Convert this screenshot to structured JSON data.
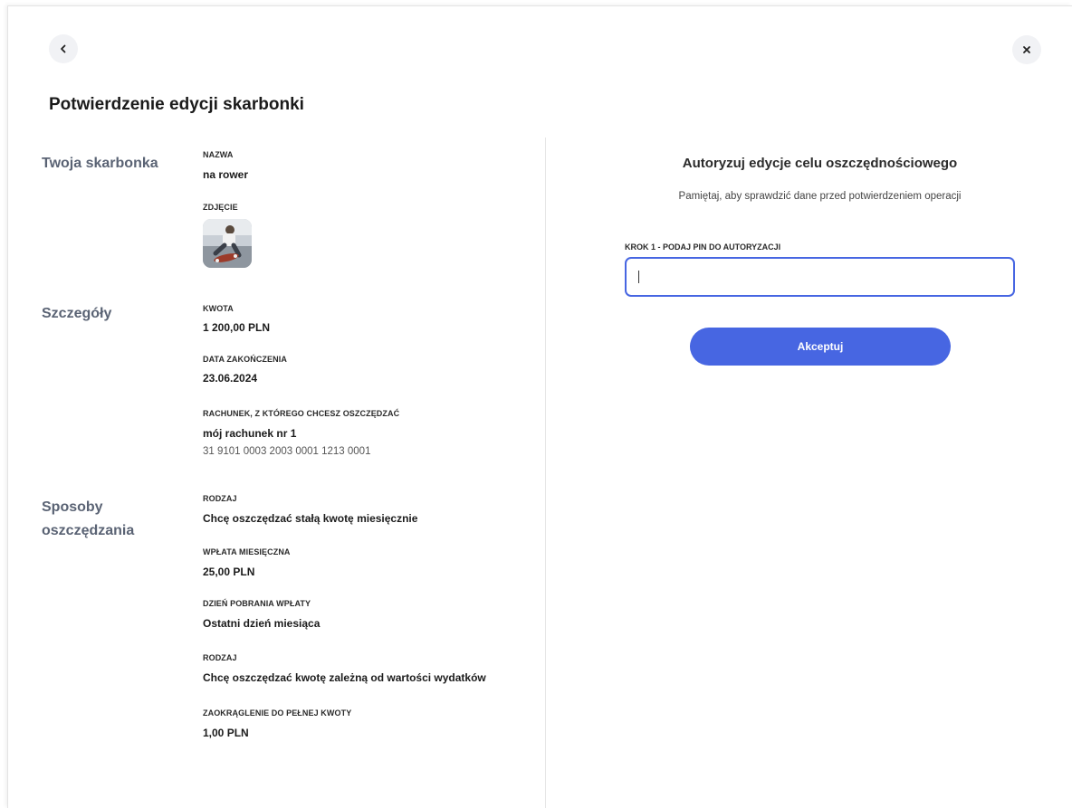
{
  "header": {
    "back_icon": "chevron-left-icon",
    "close_icon": "close-icon",
    "title": "Potwierdzenie edycji skarbonki"
  },
  "sections": {
    "piggy": {
      "title": "Twoja skarbonka",
      "name_label": "NAZWA",
      "name_value": "na rower",
      "photo_label": "ZDJĘCIE"
    },
    "details": {
      "title": "Szczegóły",
      "amount_label": "KWOTA",
      "amount_value": "1 200,00 PLN",
      "end_date_label": "DATA ZAKOŃCZENIA",
      "end_date_value": "23.06.2024",
      "account_label": "RACHUNEK, Z KTÓREGO CHCESZ OSZCZĘDZAĆ",
      "account_name": "mój rachunek nr 1",
      "account_number": "31 9101 0003 2003 0001 1213 0001"
    },
    "methods": {
      "title_line1": "Sposoby",
      "title_line2": "oszczędzania",
      "type1_label": "RODZAJ",
      "type1_value": "Chcę oszczędzać stałą kwotę miesięcznie",
      "monthly_label": "WPŁATA MIESIĘCZNA",
      "monthly_value": "25,00 PLN",
      "day_label": "DZIEŃ POBRANIA WPŁATY",
      "day_value": "Ostatni dzień miesiąca",
      "type2_label": "RODZAJ",
      "type2_value": "Chcę oszczędzać kwotę zależną od wartości wydatków",
      "rounding_label": "ZAOKRĄGLENIE DO PEŁNEJ KWOTY",
      "rounding_value": "1,00 PLN"
    }
  },
  "auth": {
    "title": "Autoryzuj edycje celu oszczędnościowego",
    "hint": "Pamiętaj, aby sprawdzić dane przed potwierdzeniem operacji",
    "step_label": "KROK 1 - PODAJ PIN DO AUTORYZACJI",
    "pin_value": "",
    "accept_label": "Akceptuj"
  },
  "colors": {
    "accent": "#4766e2",
    "section_title": "#5a6374"
  }
}
